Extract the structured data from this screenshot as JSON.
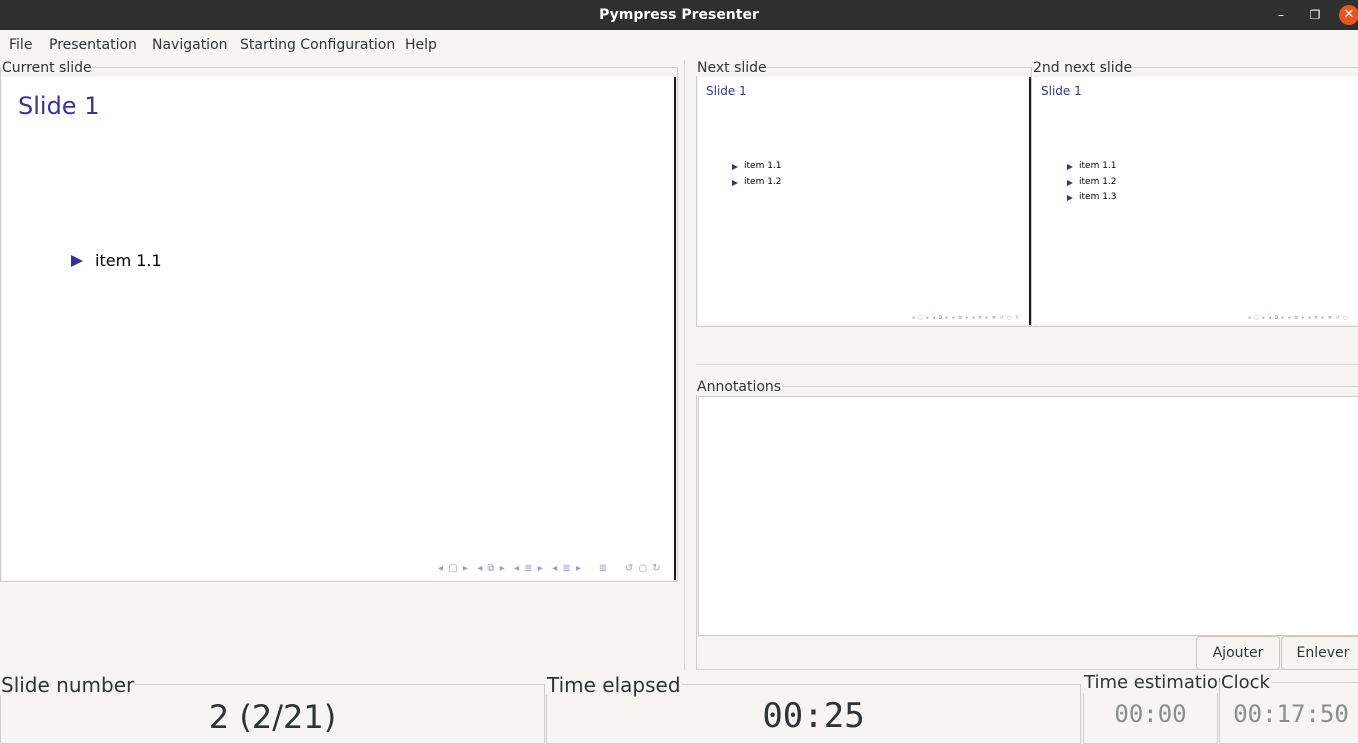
{
  "window": {
    "title": "Pympress Presenter",
    "controls": {
      "minimize": "–",
      "maximize": "❐",
      "close": "✕"
    }
  },
  "menu": {
    "items": [
      "File",
      "Presentation",
      "Navigation",
      "Starting Configuration",
      "Help"
    ]
  },
  "current_slide": {
    "label": "Current slide",
    "title": "Slide 1",
    "items": [
      "item 1.1"
    ]
  },
  "next_slide": {
    "label": "Next slide",
    "title": "Slide 1",
    "items": [
      "item 1.1",
      "item 1.2"
    ]
  },
  "second_next_slide": {
    "label": "2nd next slide",
    "title": "Slide 1",
    "items": [
      "item 1.1",
      "item 1.2",
      "item 1.3"
    ]
  },
  "annotations": {
    "label": "Annotations",
    "text": "",
    "add_button": "Ajouter",
    "remove_button": "Enlever"
  },
  "slide_number": {
    "label": "Slide number",
    "value": "2 (2/21)"
  },
  "time_elapsed": {
    "label": "Time elapsed",
    "value": "00:25"
  },
  "time_estimation": {
    "label": "Time estimation",
    "value": "00:00"
  },
  "clock": {
    "label": "Clock",
    "value": "00:17:50"
  },
  "colors": {
    "titlebar": "#2f2f2f",
    "close_button": "#e95420",
    "slide_title": "#33339f",
    "nav_symbols": "#9a9ad6"
  }
}
